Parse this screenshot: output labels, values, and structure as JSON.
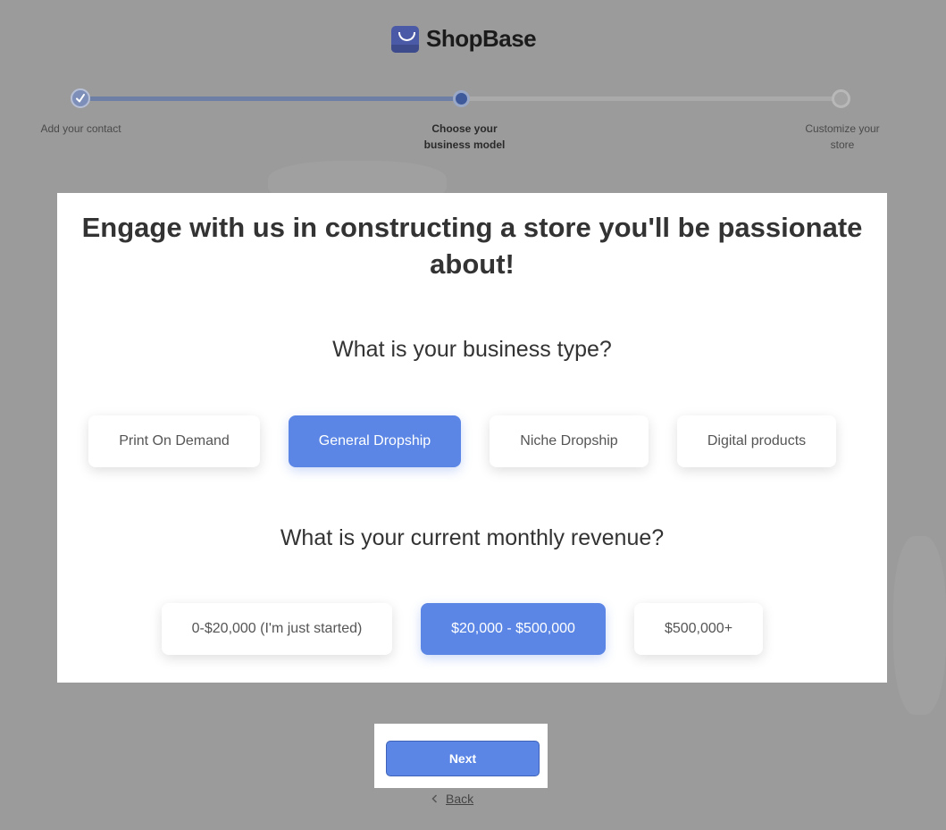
{
  "brand": {
    "name": "ShopBase",
    "logo_icon": "shopbase-bag-icon"
  },
  "stepper": {
    "steps": [
      {
        "label": "Add your contact",
        "state": "completed"
      },
      {
        "label": "Choose your business model",
        "label_lines": [
          "Choose your",
          "business model"
        ],
        "state": "active"
      },
      {
        "label": "Customize your store",
        "label_lines": [
          "Customize your",
          "store"
        ],
        "state": "pending"
      }
    ],
    "progress": 0.5
  },
  "card": {
    "headline_lines": [
      "Engage with us in constructing a store you'll be passionate",
      "about!"
    ],
    "business_type": {
      "question": "What is your business type?",
      "options": [
        "Print On Demand",
        "General Dropship",
        "Niche Dropship",
        "Digital products"
      ],
      "selected": "General Dropship"
    },
    "revenue": {
      "question": "What is your current monthly revenue?",
      "options": [
        "0-$20,000 (I'm just started)",
        "$20,000 - $500,000",
        "$500,000+"
      ],
      "selected": "$20,000 - $500,000"
    }
  },
  "actions": {
    "next_label": "Next",
    "back_label": "Back"
  },
  "colors": {
    "accent": "#5b86e5",
    "overlay": "#9b9b9b",
    "stepper_active": "#3f5a9a"
  }
}
